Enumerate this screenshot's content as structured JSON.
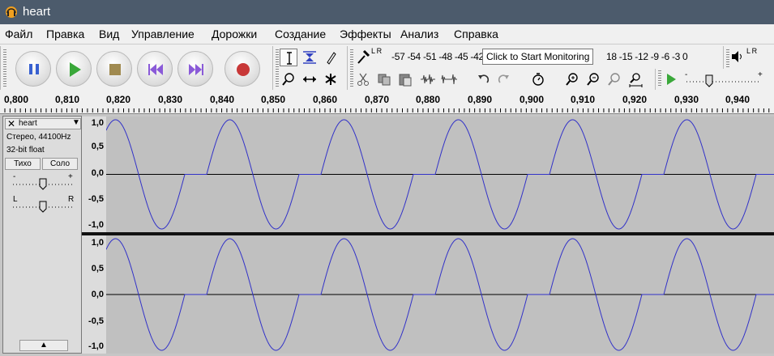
{
  "window": {
    "title": "heart"
  },
  "menu": [
    "Файл",
    "Правка",
    "Вид",
    "Управление",
    "Дорожки",
    "Создание",
    "Эффекты",
    "Анализ",
    "Справка"
  ],
  "meter": {
    "record_scale": "-57 -54 -51 -48 -45 -42",
    "playback_scale": "18 -15 -12  -9  -6  -3  0",
    "tooltip": "Click to Start Monitoring",
    "record_channels": "L R",
    "playback_channels": "L R"
  },
  "ruler": {
    "ticks": [
      "0,800",
      "0,810",
      "0,820",
      "0,830",
      "0,840",
      "0,850",
      "0,860",
      "0,870",
      "0,880",
      "0,890",
      "0,900",
      "0,910",
      "0,920",
      "0,930",
      "0,940"
    ]
  },
  "track": {
    "name": "heart",
    "format_line1": "Стерео, 44100Hz",
    "format_line2": "32-bit float",
    "mute_label": "Тихо",
    "solo_label": "Соло",
    "gain_minus": "-",
    "gain_plus": "+",
    "pan_left": "L",
    "pan_right": "R",
    "close_glyph": "✕",
    "menu_arrow": "▼",
    "collapse_glyph": "▲"
  },
  "amplitude_labels": [
    "1,0",
    "0,5",
    "0,0",
    "-0,5",
    "-1,0"
  ],
  "colors": {
    "waveform": "#3232c8",
    "selection_bg": "#c0c0c0",
    "titlebar": "#4c5b6c"
  },
  "icons": [
    "pause-icon",
    "play-icon",
    "stop-icon",
    "skip-start-icon",
    "skip-end-icon",
    "record-icon"
  ]
}
